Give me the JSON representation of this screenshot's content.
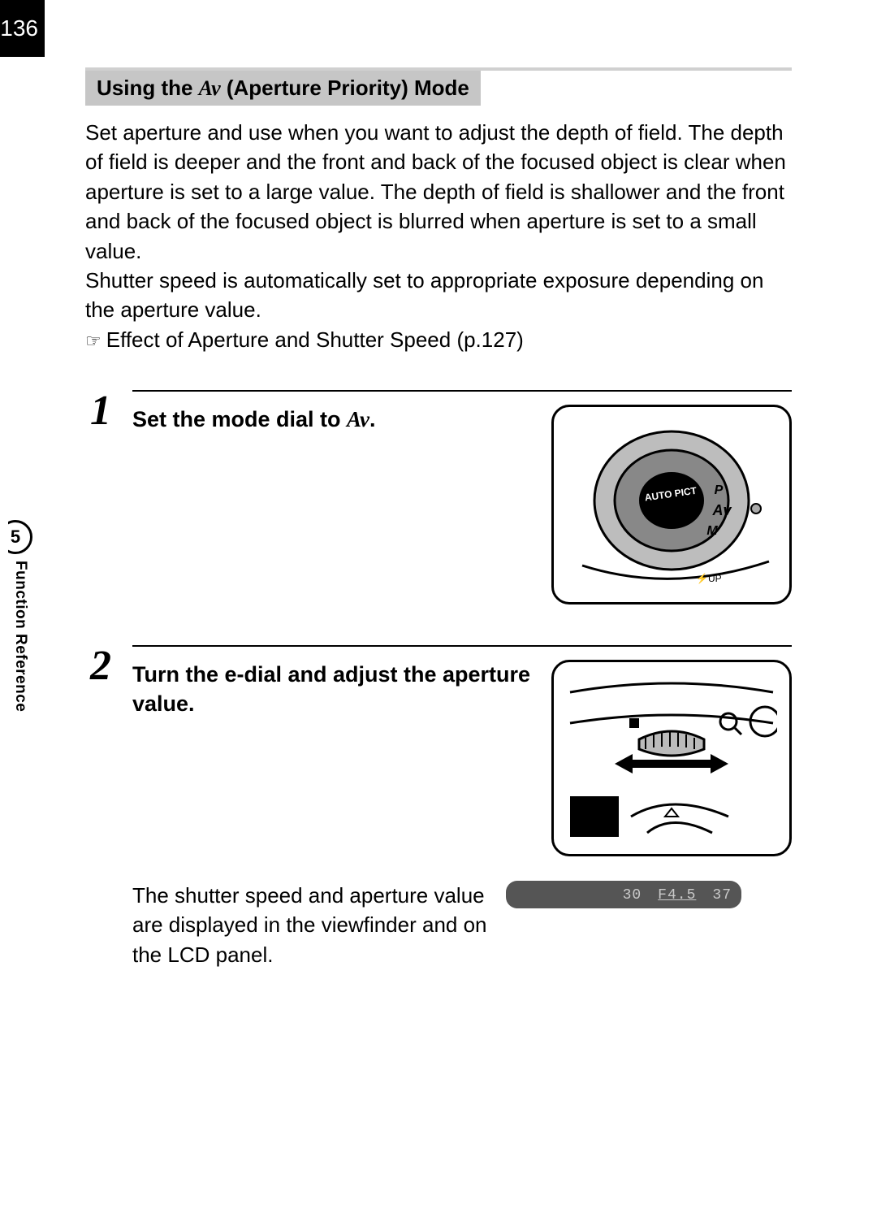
{
  "page_number": "136",
  "section_title_prefix": "Using the ",
  "section_title_mode": "Av",
  "section_title_suffix": " (Aperture Priority) Mode",
  "intro_para": "Set aperture and use when you want to adjust the depth of field. The depth of field is deeper and the front and back of the focused object is clear when aperture is set to a large value. The depth of field is shallower and the front and back of the focused object is blurred when aperture is set to a small value.",
  "intro_para2": "Shutter speed is automatically set to appropriate exposure depending on the aperture value.",
  "crossref": "Effect of Aperture and Shutter Speed (p.127)",
  "steps": {
    "s1": {
      "num": "1",
      "text_prefix": "Set the mode dial to ",
      "text_mode": "Av",
      "text_suffix": "."
    },
    "s2": {
      "num": "2",
      "text": "Turn the e-dial and adjust the aperture value.",
      "note": "The shutter speed and aperture value are displayed in the viewfinder and on the LCD panel."
    }
  },
  "viewfinder": {
    "shutter": "30",
    "aperture": "F4.5",
    "frames": "37"
  },
  "sidebar": {
    "chapter": "5",
    "label": "Function Reference"
  },
  "mode_dial_text": "AUTO PICT",
  "mode_dial_av": "Av",
  "mode_dial_m": "M",
  "mode_dial_p": "P",
  "edial_arrow": "↔"
}
